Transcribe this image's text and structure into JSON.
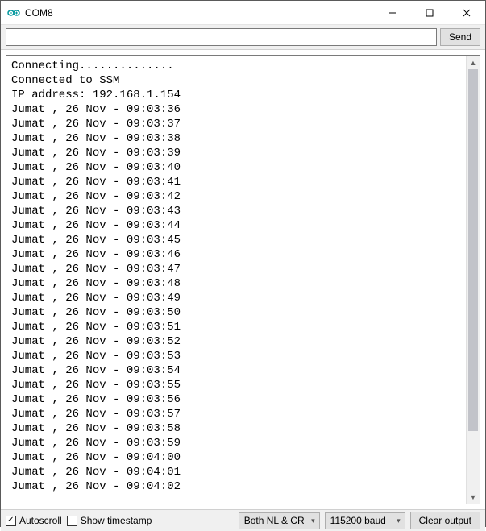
{
  "window": {
    "title": "COM8"
  },
  "toolbar": {
    "send_label": "Send",
    "input_value": ""
  },
  "output": {
    "lines": [
      "Connecting..............",
      "Connected to SSM",
      "IP address: 192.168.1.154",
      "Jumat , 26 Nov - 09:03:36",
      "Jumat , 26 Nov - 09:03:37",
      "Jumat , 26 Nov - 09:03:38",
      "Jumat , 26 Nov - 09:03:39",
      "Jumat , 26 Nov - 09:03:40",
      "Jumat , 26 Nov - 09:03:41",
      "Jumat , 26 Nov - 09:03:42",
      "Jumat , 26 Nov - 09:03:43",
      "Jumat , 26 Nov - 09:03:44",
      "Jumat , 26 Nov - 09:03:45",
      "Jumat , 26 Nov - 09:03:46",
      "Jumat , 26 Nov - 09:03:47",
      "Jumat , 26 Nov - 09:03:48",
      "Jumat , 26 Nov - 09:03:49",
      "Jumat , 26 Nov - 09:03:50",
      "Jumat , 26 Nov - 09:03:51",
      "Jumat , 26 Nov - 09:03:52",
      "Jumat , 26 Nov - 09:03:53",
      "Jumat , 26 Nov - 09:03:54",
      "Jumat , 26 Nov - 09:03:55",
      "Jumat , 26 Nov - 09:03:56",
      "Jumat , 26 Nov - 09:03:57",
      "Jumat , 26 Nov - 09:03:58",
      "Jumat , 26 Nov - 09:03:59",
      "Jumat , 26 Nov - 09:04:00",
      "Jumat , 26 Nov - 09:04:01",
      "Jumat , 26 Nov - 09:04:02"
    ]
  },
  "footer": {
    "autoscroll_label": "Autoscroll",
    "autoscroll_checked": true,
    "timestamp_label": "Show timestamp",
    "timestamp_checked": false,
    "line_ending_selected": "Both NL & CR",
    "baud_selected": "115200 baud",
    "clear_label": "Clear output"
  }
}
